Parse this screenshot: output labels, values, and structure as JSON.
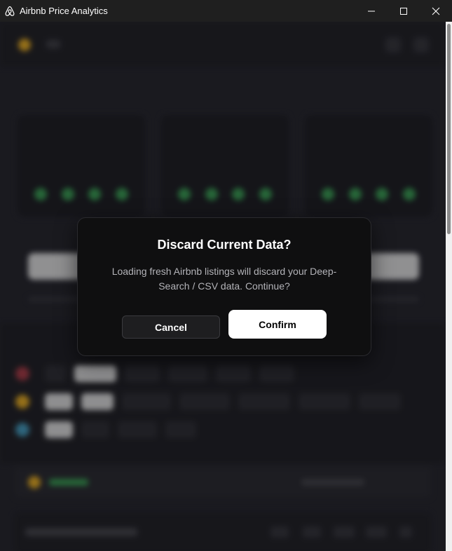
{
  "window": {
    "title": "Airbnb Price Analytics",
    "icons": {
      "app": "airbnb-logo-icon",
      "minimize": "minimize-icon",
      "maximize": "maximize-icon",
      "close": "close-icon"
    }
  },
  "dialog": {
    "title": "Discard Current Data?",
    "message": "Loading fresh Airbnb listings will discard your Deep-Search / CSV data. Continue?",
    "cancel_label": "Cancel",
    "confirm_label": "Confirm"
  },
  "colors": {
    "dialog_bg": "#0f0f10",
    "confirm_bg": "#ffffff",
    "cancel_bg": "#1e1e20",
    "accent_green": "#3fa55b",
    "accent_yellow": "#f0b429"
  }
}
